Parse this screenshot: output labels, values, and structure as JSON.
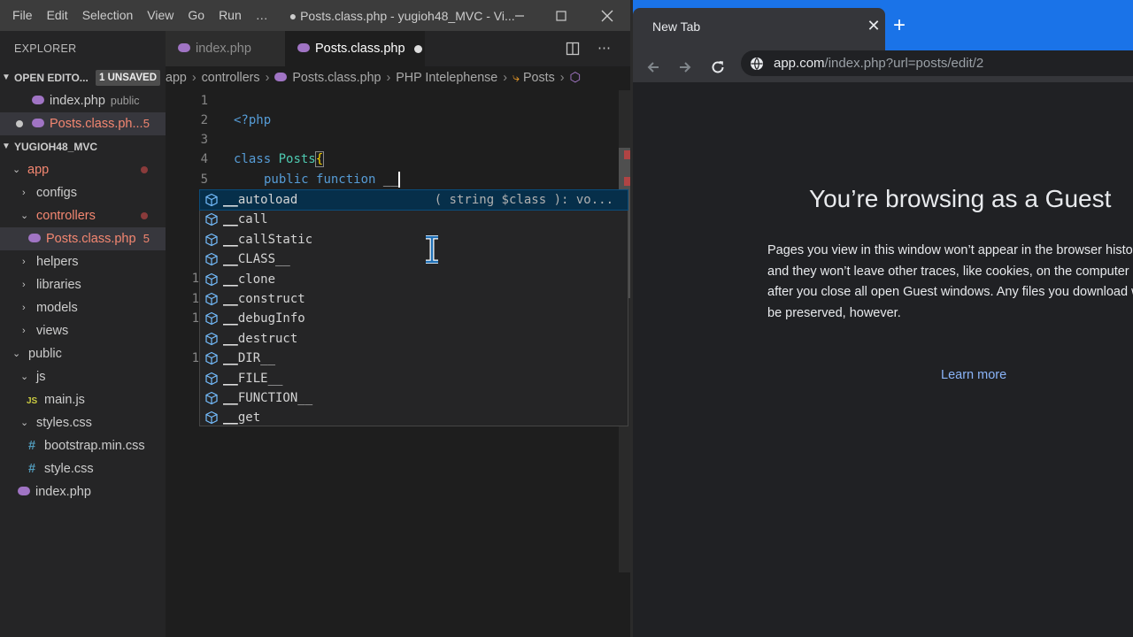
{
  "vscode": {
    "menu": [
      "File",
      "Edit",
      "Selection",
      "View",
      "Go",
      "Run",
      "…"
    ],
    "window_title": "● Posts.class.php - yugioh48_MVC - Vi...",
    "explorer_title": "EXPLORER",
    "open_editors": {
      "header": "OPEN EDITO...",
      "badge": "1 UNSAVED",
      "items": [
        {
          "label": "index.php",
          "hint": "public"
        },
        {
          "label": "Posts.class.ph...",
          "count": "5"
        }
      ]
    },
    "project": {
      "header": "YUGIOH48_MVC",
      "app": "app",
      "configs": "configs",
      "controllers": "controllers",
      "posts_file": "Posts.class.php",
      "posts_count": "5",
      "helpers": "helpers",
      "libraries": "libraries",
      "models": "models",
      "views": "views",
      "public": "public",
      "js": "js",
      "main_js": "main.js",
      "js_badge": "JS",
      "styles_css": "styles.css",
      "bootstrap": "bootstrap.min.css",
      "style_css": "style.css",
      "css_badge": "#",
      "index_php": "index.php"
    },
    "tabs": [
      {
        "label": "index.php"
      },
      {
        "label": "Posts.class.php"
      }
    ],
    "breadcrumb": {
      "parts": [
        "app",
        "controllers",
        "Posts.class.php",
        "PHP Intelephense",
        "Posts"
      ],
      "sep": "›"
    },
    "editor": {
      "line_numbers": [
        "1",
        "2",
        "3",
        "4",
        "5",
        "1",
        "1",
        "1",
        "1"
      ],
      "php_open": "<?php",
      "class_kw": "class",
      "class_name": "Posts",
      "brace": "{",
      "public_kw": "public",
      "function_kw": "function",
      "typed": "__"
    },
    "suggestions": [
      {
        "label": "autoload",
        "detail": "( string $class ): vo..."
      },
      {
        "label": "call"
      },
      {
        "label": "callStatic"
      },
      {
        "label": "CLASS__"
      },
      {
        "label": "clone"
      },
      {
        "label": "construct"
      },
      {
        "label": "debugInfo"
      },
      {
        "label": "destruct"
      },
      {
        "label": "DIR__"
      },
      {
        "label": "FILE__"
      },
      {
        "label": "FUNCTION__"
      },
      {
        "label": "get"
      }
    ],
    "suggest_prefix": "__"
  },
  "chrome": {
    "tab_title": "New Tab",
    "close_glyph": "✕",
    "plus_glyph": "+",
    "url_host": "app.com",
    "url_path": "/index.php?url=posts/edit/2",
    "guest_heading": "You’re browsing as a Guest",
    "guest_body": "Pages you view in this window won’t appear in the browser history and they won’t leave other traces, like cookies, on the computer after you close all open Guest windows. Any files you download will be preserved, however.",
    "learn_more": "Learn more"
  },
  "colors": {
    "vscode_bg": "#1e1e1e",
    "chrome_tabstrip": "#1a73e8",
    "chrome_bg": "#202124",
    "link": "#8ab4f8",
    "modified_red": "#f48771"
  }
}
